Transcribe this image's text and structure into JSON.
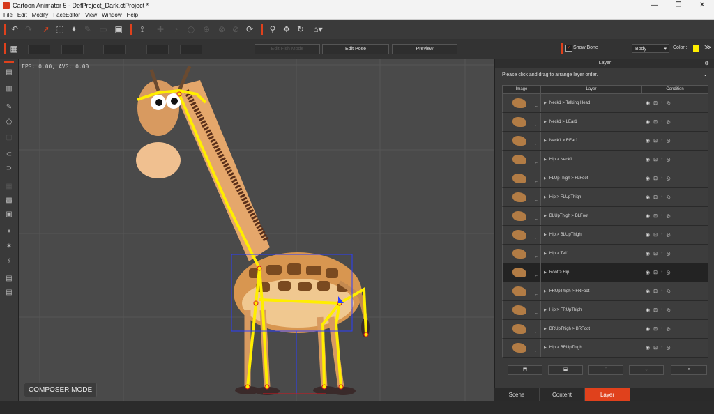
{
  "window": {
    "title": "Cartoon Animator 5 - DefProject_Dark.ctProject *",
    "minimize": "—",
    "maximize": "❐",
    "close": "✕"
  },
  "menu": [
    "File",
    "Edit",
    "Modify",
    "FaceEditor",
    "View",
    "Window",
    "Help"
  ],
  "toolbar2": {
    "edit_pose_btn_disabled": "Edit Fish Mode",
    "edit_pose": "Edit Pose",
    "preview": "Preview",
    "show_bone": "Show Bone",
    "show_bone_checked": "✓",
    "body_select": "Body",
    "color_label": "Color :",
    "color_value": "#ffee00",
    "expand": "≫"
  },
  "viewport": {
    "fps": "FPS: 0.00, AVG: 0.00",
    "mode": "COMPOSER MODE"
  },
  "layer_panel": {
    "title": "Layer",
    "hint": "Please click and drag to arrange layer order.",
    "columns": {
      "image": "Image",
      "layer": "Layer",
      "condition": "Condition"
    },
    "rows": [
      {
        "name": "Neck1 > Talking Head",
        "selected": false
      },
      {
        "name": "Neck1 > LEar1",
        "selected": false
      },
      {
        "name": "Neck1 > REar1",
        "selected": false
      },
      {
        "name": "Hip > Neck1",
        "selected": false
      },
      {
        "name": "FLUpThigh > FLFoot",
        "selected": false
      },
      {
        "name": "Hip > FLUpThigh",
        "selected": false
      },
      {
        "name": "BLUpThigh > BLFoot",
        "selected": false
      },
      {
        "name": "Hip > BLUpThigh",
        "selected": false
      },
      {
        "name": "Hip > Tail1",
        "selected": false
      },
      {
        "name": "Root > Hip",
        "selected": true
      },
      {
        "name": "FRUpThigh > FRFoot",
        "selected": false
      },
      {
        "name": "Hip > FRUpThigh",
        "selected": false
      },
      {
        "name": "BRUpThigh > BRFoot",
        "selected": false
      },
      {
        "name": "Hip > BRUpThigh",
        "selected": false
      }
    ],
    "close_btn": "✕"
  },
  "tabs": [
    {
      "label": "Scene",
      "active": false
    },
    {
      "label": "Content",
      "active": false
    },
    {
      "label": "Layer",
      "active": true
    }
  ],
  "colors": {
    "accent": "#e0411c",
    "bone": "#ffee00",
    "bg": "#4a4a4a"
  }
}
